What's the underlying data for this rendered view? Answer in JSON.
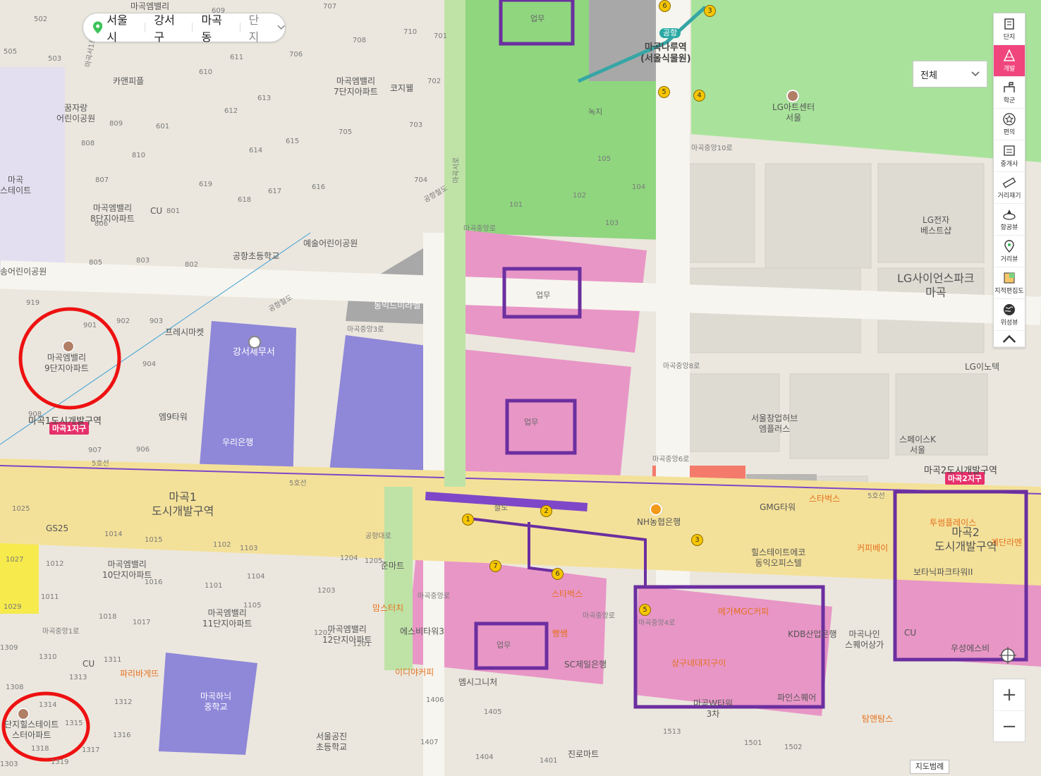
{
  "breadcrumb": {
    "city": "서울시",
    "district": "강서구",
    "dong": "마곡동",
    "type": "단지"
  },
  "filter": {
    "selected": "전체"
  },
  "toolbar": [
    {
      "id": "complex",
      "label": "단지",
      "icon": "building-icon"
    },
    {
      "id": "development",
      "label": "개발",
      "icon": "development-icon",
      "active": true
    },
    {
      "id": "school",
      "label": "학군",
      "icon": "school-icon"
    },
    {
      "id": "amenity",
      "label": "편의",
      "icon": "star-icon"
    },
    {
      "id": "agent",
      "label": "중개사",
      "icon": "agent-icon"
    },
    {
      "id": "ruler",
      "label": "거리재기",
      "icon": "ruler-icon"
    },
    {
      "id": "aerial",
      "label": "항공뷰",
      "icon": "aerial-icon"
    },
    {
      "id": "street",
      "label": "거리뷰",
      "icon": "pin-icon"
    },
    {
      "id": "cadastral",
      "label": "지적편집도",
      "icon": "cadastral-icon"
    },
    {
      "id": "satellite",
      "label": "위성뷰",
      "icon": "globe-icon"
    }
  ],
  "zoom": {
    "in": "+",
    "out": "−"
  },
  "legend_button": "지도범례",
  "colors": {
    "business_zone_pink": "#e896c6",
    "residential_purple": "#8f87d8",
    "park_green": "#8fd67f",
    "annotation_purple": "#6b2fa0",
    "annotation_red": "#ee1111",
    "road_yellow": "#f4e199",
    "active_tool": "#f0457d"
  },
  "map": {
    "zone_labels": [
      "업무",
      "업무",
      "업무",
      "업무"
    ],
    "stations": {
      "magoknaru": "마곡나루역\n(서울식물원)",
      "airport_tag": "공항"
    },
    "districts": {
      "magok1_big": "마곡1\n도시개발구역",
      "magok2_big": "마곡2\n도시개발구역",
      "magok1_tag": "마곡1지구",
      "magok2_tag": "마곡2지구",
      "magok1_line": "마곡1도시개발구역",
      "magok2_line": "마곡2도시개발구역"
    },
    "lines": {
      "line5": "5호선",
      "rail": "철도",
      "airport_rail": "공항철도"
    },
    "roads": [
      "마곡중앙로",
      "마곡중앙3로",
      "마곡중앙8로",
      "마곡중앙6로",
      "마곡중앙4로",
      "마곡중앙1로",
      "마곡중앙10로",
      "마곡서로",
      "공항대로",
      "마곡중앙로",
      "마곡서1로",
      "마곡중앙로"
    ],
    "places": {
      "lg_art": "LG아트센터\n서울",
      "lg_science": "LG사이언스파크\n마곡",
      "lg_best": "LG전자\n베스트샵",
      "lg_innotek": "LG이노텍",
      "green": "녹지",
      "kanfp": "카앤피플",
      "kozi": "코지웰",
      "yesul_park": "예술어린이공원",
      "airport_elem": "공항초등학교",
      "dongik": "동익드미라벨",
      "gangseo_tax": "강서세무서",
      "woori": "우리은행",
      "fresh": "프레시마켓",
      "m9": "엠9타워",
      "gs25": "GS25",
      "junmart": "준마트",
      "starbucks1": "스타벅스",
      "starbucks2": "스타벅스",
      "nh": "NH농협은행",
      "gmg": "GMG타워",
      "seoul_hub": "서울창업허브\n엠플러스",
      "space_k": "스페이스K\n서울",
      "hills": "힐스테이트에코\n동익오피스텔",
      "coffee_bay": "커피베이",
      "twosome": "투썸플레이스",
      "botanic": "보타닉파크타워II",
      "cu1": "CU",
      "cu2": "CU",
      "cu3": "CU",
      "kdb": "KDB산업은행",
      "mega": "메가MGC커피",
      "sangku": "상구네대지구이",
      "pine": "파인스퀘어",
      "magok_w": "마곡W타워\n3차",
      "magok_nine": "마곡나인\n스퀘어상가",
      "woosung": "우성에스비",
      "tom": "탐앤탐스",
      "ediya": "이디야커피",
      "esbt": "에스비타워3",
      "signature": "엠시그니처",
      "bbang": "빵쌤",
      "sc": "SC제일은행",
      "mamstouch": "맘스터치",
      "paris": "파리바게뜨",
      "magok_middle": "마곡하늬\n중학교",
      "gongjin": "서울공진\n초등학교",
      "jinro": "진로마트",
      "ggumjarang": "꿈자랑\n어린이공원",
      "song_park": "송어린이공원",
      "magok_estate": "마곡\n스테이트",
      "ge": "계단라멘",
      "danji_hills": "단지힐스테이트\n스터아파트"
    },
    "apartments": {
      "apt7": "마곡엠밸리\n7단지아파트",
      "apt8": "마곡엠밸리\n8단지아파트",
      "apt9": "마곡엠밸리\n9단지아파트",
      "apt10": "마곡엠밸리\n10단지아파트",
      "apt11": "마곡엠밸리\n11단지아파트",
      "apt12": "마곡엠밸리\n12단지아파트",
      "top": "마곡엠밸리"
    },
    "building_numbers": [
      "707",
      "710",
      "701",
      "708",
      "702",
      "706",
      "611",
      "610",
      "612",
      "613",
      "615",
      "614",
      "616",
      "617",
      "618",
      "619",
      "601",
      "705",
      "703",
      "704",
      "809",
      "808",
      "810",
      "807",
      "801",
      "806",
      "805",
      "803",
      "802",
      "919",
      "902",
      "903",
      "901",
      "904",
      "908",
      "907",
      "906",
      "1025",
      "1014",
      "1015",
      "1102",
      "1103",
      "1204",
      "1205",
      "1012",
      "1016",
      "1027",
      "1011",
      "1101",
      "1104",
      "1203",
      "1029",
      "1018",
      "1017",
      "1105",
      "1201",
      "1202",
      "1310",
      "1311",
      "1313",
      "1308",
      "1314",
      "1315",
      "1312",
      "1316",
      "1318",
      "1317",
      "1406",
      "1405",
      "1407",
      "1404",
      "1401",
      "1513",
      "1501",
      "1502",
      "101",
      "102",
      "103",
      "104",
      "105",
      "1309",
      "1303",
      "1319",
      "505",
      "503",
      "502",
      "609"
    ],
    "station_numbers": [
      "1",
      "2",
      "3",
      "4",
      "5",
      "6",
      "7",
      "3",
      "5",
      "6"
    ]
  }
}
